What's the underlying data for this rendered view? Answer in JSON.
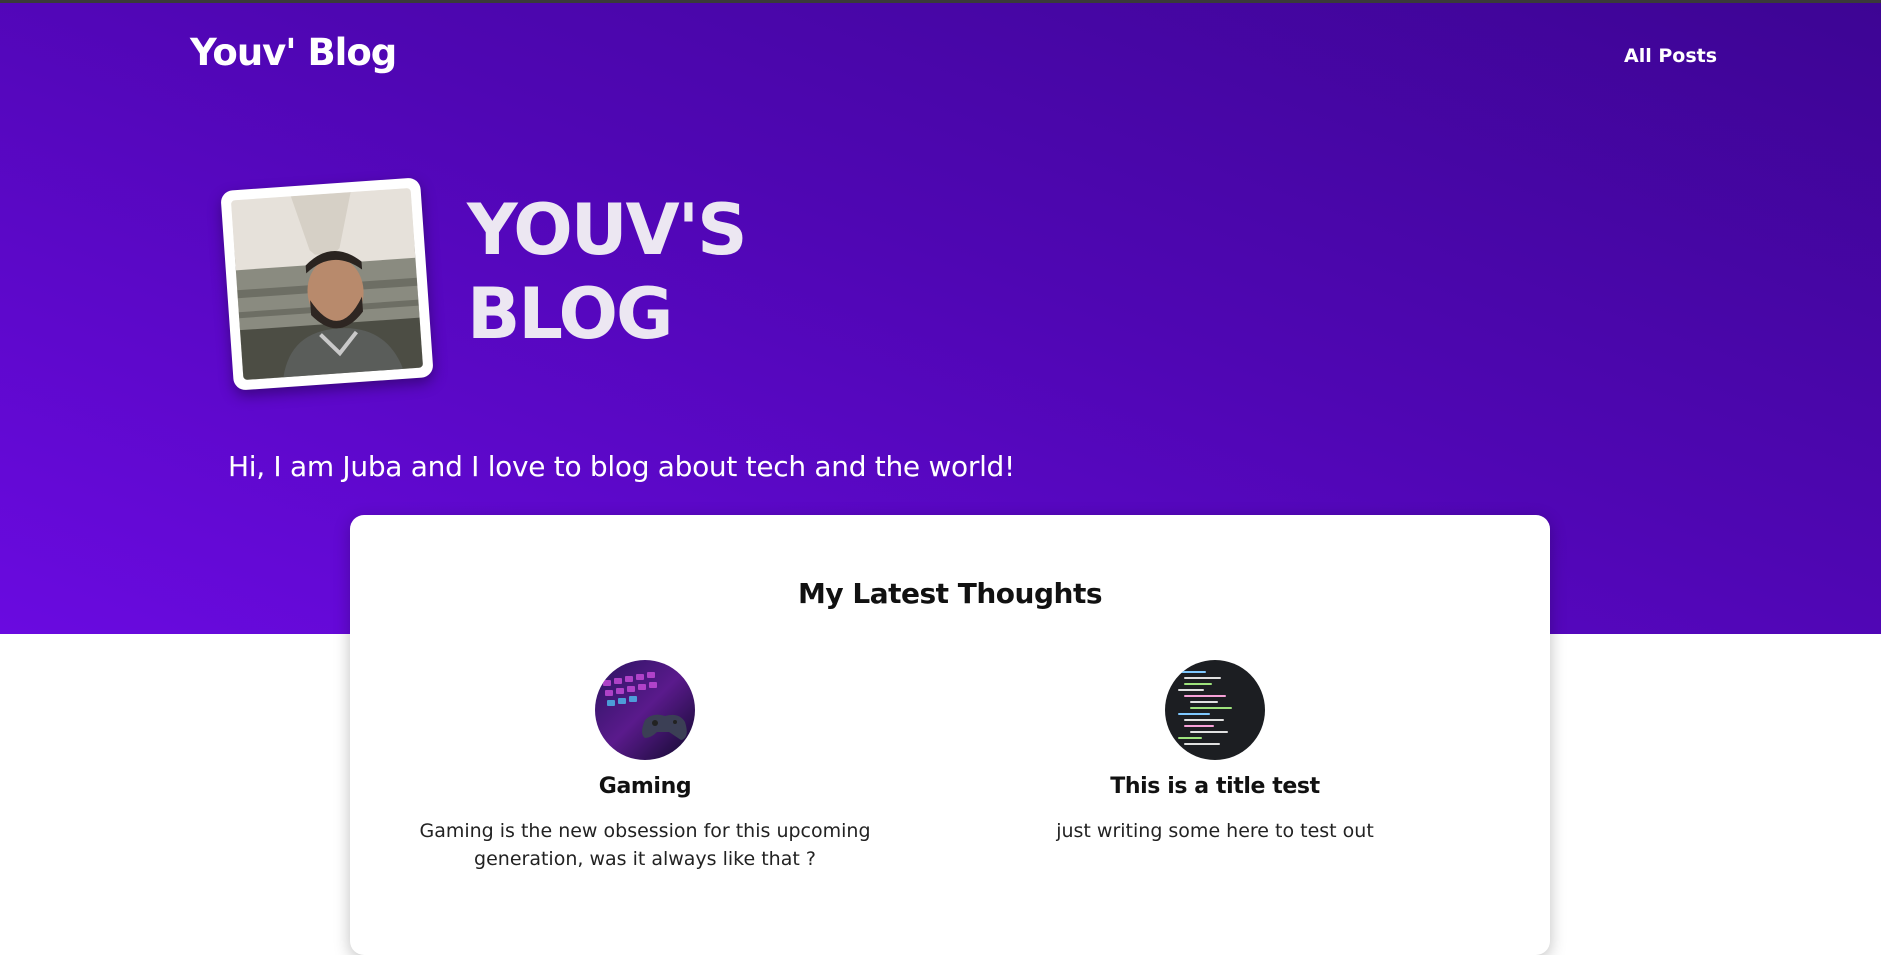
{
  "header": {
    "brand": "Youv' Blog",
    "nav": [
      {
        "label": "All Posts"
      }
    ]
  },
  "hero": {
    "title_line1": "YOUV'S",
    "title_line2": "BLOG",
    "tagline": "Hi, I am Juba and I love to blog about tech and the world!"
  },
  "latest": {
    "heading": "My Latest Thoughts",
    "posts": [
      {
        "title": "Gaming",
        "excerpt": "Gaming is the new obsession for this upcoming generation, was it always like that ?",
        "thumbnail": "gaming-keyboard-controller-image"
      },
      {
        "title": "This is a title test",
        "excerpt": "just writing some here to test out",
        "thumbnail": "code-editor-image"
      }
    ]
  },
  "colors": {
    "hero_gradient_start": "#3d0594",
    "hero_gradient_end": "#6a0ae0",
    "card_background": "#ffffff",
    "text_light": "#ffffff"
  }
}
